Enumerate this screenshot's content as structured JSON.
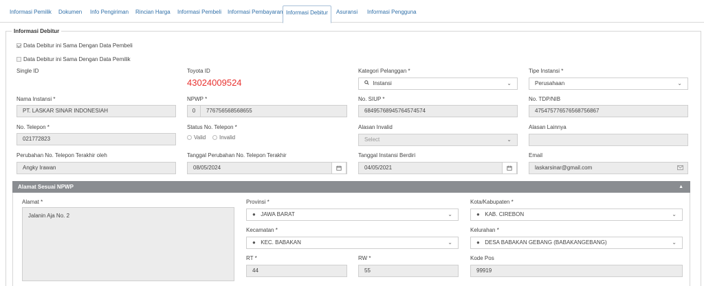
{
  "tabs": [
    {
      "label": "Informasi Pemilik"
    },
    {
      "label": "Dokumen"
    },
    {
      "label": "Info Pengiriman"
    },
    {
      "label": "Rincian Harga"
    },
    {
      "label": "Informasi Pembeli"
    },
    {
      "label": "Informasi Pembayaran"
    },
    {
      "label": "Informasi Debitur"
    },
    {
      "label": "Asuransi"
    },
    {
      "label": "Informasi Pengguna"
    }
  ],
  "active_tab": "Informasi Debitur",
  "section_title": "Informasi Debitur",
  "checkboxes": {
    "same_as_buyer": {
      "label": "Data Debitur ini Sama Dengan Data Pembeli",
      "checked": true
    },
    "same_as_owner": {
      "label": "Data Debitur ini Sama Dengan Data Pemilik",
      "checked": false
    }
  },
  "single_id": {
    "label": "Single ID"
  },
  "toyota_id": {
    "label": "Toyota ID",
    "value": "43024009524"
  },
  "kategori_pelanggan": {
    "label": "Kategori Pelanggan *",
    "value": "Instansi"
  },
  "tipe_instansi": {
    "label": "Tipe Instansi *",
    "value": "Perusahaan"
  },
  "nama_instansi": {
    "label": "Nama Instansi *",
    "value": "PT. LASKAR SINAR INDONESIAH"
  },
  "npwp": {
    "label": "NPWP *",
    "prefix": "0",
    "value": "776756568568655"
  },
  "no_siup": {
    "label": "No. SIUP *",
    "value": "68495768945764574574"
  },
  "no_tdp": {
    "label": "No. TDP/NIB",
    "value": "475475776576568756867"
  },
  "no_telepon": {
    "label": "No. Telepon *",
    "value": "021772823"
  },
  "status_telepon": {
    "label": "Status No. Telepon *",
    "opt_valid": "Valid",
    "opt_invalid": "Invalid"
  },
  "alasan_invalid": {
    "label": "Alasan Invalid",
    "placeholder": "Select"
  },
  "alasan_lainnya": {
    "label": "Alasan Lainnya",
    "value": ""
  },
  "perubahan_oleh": {
    "label": "Perubahan No. Telepon Terakhir oleh",
    "value": "Angky Irawan"
  },
  "tanggal_perubahan": {
    "label": "Tanggal Perubahan No. Telepon Terakhir",
    "value": "08/05/2024"
  },
  "tanggal_berdiri": {
    "label": "Tanggal Instansi Berdiri",
    "value": "04/05/2021"
  },
  "email": {
    "label": "Email",
    "value": "laskarsinar@gmail.com"
  },
  "alamat_npwp": {
    "title": "Alamat Sesuai NPWP",
    "alamat": {
      "label": "Alamat *",
      "value": "Jalanin Aja No. 2"
    },
    "provinsi": {
      "label": "Provinsi *",
      "value": "JAWA BARAT"
    },
    "kota": {
      "label": "Kota/Kabupaten *",
      "value": "KAB. CIREBON"
    },
    "kecamatan": {
      "label": "Kecamatan *",
      "value": "KEC. BABAKAN"
    },
    "kelurahan": {
      "label": "Kelurahan *",
      "value": "DESA BABAKAN GEBANG (BABAKANGEBANG)"
    },
    "rt": {
      "label": "RT *",
      "value": "44"
    },
    "rw": {
      "label": "RW *",
      "value": "55"
    },
    "kode_pos": {
      "label": "Kode Pos",
      "value": "99919"
    }
  },
  "colors": {
    "accent": "#2f6fa8",
    "toyota_id": "#e8312f",
    "section_bar": "#8a8d91"
  }
}
